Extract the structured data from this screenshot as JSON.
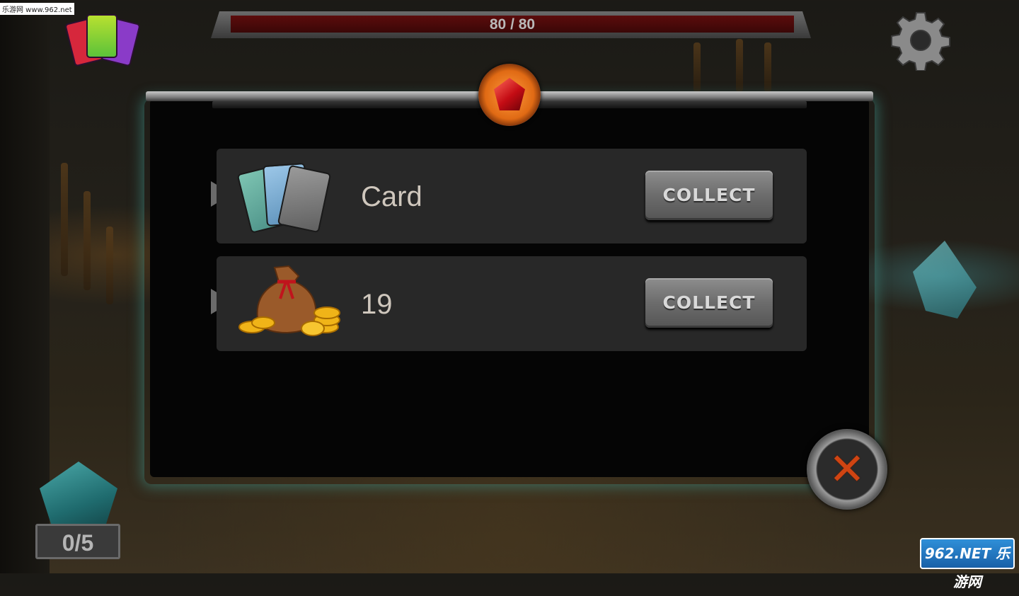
{
  "watermark": {
    "text": "乐游网 www.962.net"
  },
  "hud": {
    "health_text": "80 / 80",
    "health_fraction": 1.0,
    "gem_counter": "0/5",
    "settings_icon": "gear-icon",
    "deck_icon": "card-deck-icon"
  },
  "dialog": {
    "emblem_icon": "ruby-gem-icon",
    "rewards": [
      {
        "icon": "cards-icon",
        "label": "Card",
        "button": "COLLECT"
      },
      {
        "icon": "gold-coins-bag-icon",
        "label": "19",
        "button": "COLLECT"
      }
    ],
    "close_icon": "close-x-icon",
    "close_glyph": "✕"
  },
  "logo": {
    "text": "962.NET 乐游网"
  },
  "colors": {
    "health_fill": "#5c0c0c",
    "modal_glow": "#40968c",
    "button_face": "#6c6c6c",
    "close_x": "#d04412"
  }
}
